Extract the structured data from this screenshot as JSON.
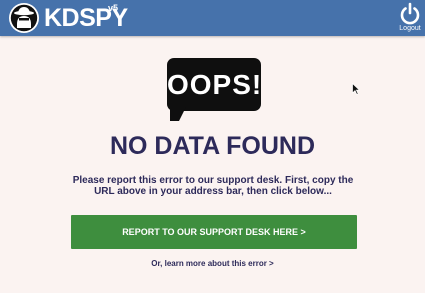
{
  "header": {
    "brand": "KDSPY",
    "version": "v5",
    "logout_label": "Logout",
    "background_color": "#4672ab",
    "logo_icon": "spy-logo-icon",
    "logout_icon": "power-icon"
  },
  "error": {
    "badge_text": "OOPS!",
    "title": "NO DATA FOUND",
    "message": "Please report this error to our support desk. First, copy the URL above in your address bar, then click below...",
    "report_button": "REPORT TO OUR SUPPORT DESK HERE >",
    "learn_more_link": "Or, learn more about this error >",
    "button_color": "#3e8e3e",
    "text_color": "#2d2a5a"
  }
}
